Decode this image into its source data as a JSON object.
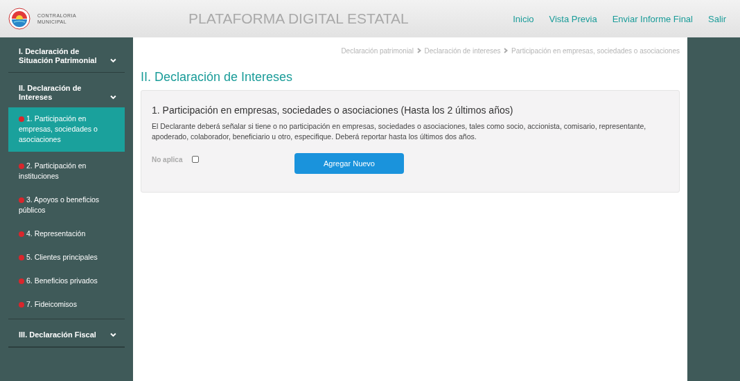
{
  "header": {
    "logo_text": [
      "CONTRALORIA",
      "MUNICIPAL"
    ],
    "title": "PLATAFORMA DIGITAL ESTATAL",
    "nav": [
      "Inicio",
      "Vista Previa",
      "Enviar Informe Final",
      "Salir"
    ]
  },
  "sidebar": {
    "sections": [
      {
        "label": "I. Declaración de Situación Patrimonial"
      },
      {
        "label": "II. Declaración de Intereses",
        "children": [
          {
            "label": "1. Participación en empresas, sociedades o asociaciones",
            "selected": true
          },
          {
            "label": "2. Participación en instituciones",
            "selected": false
          },
          {
            "label": "3. Apoyos o beneficios públicos",
            "selected": false
          },
          {
            "label": "4. Representación",
            "selected": false
          },
          {
            "label": "5. Clientes principales",
            "selected": false
          },
          {
            "label": "6. Beneficios privados",
            "selected": false
          },
          {
            "label": "7. Fideicomisos",
            "selected": false
          }
        ]
      },
      {
        "label": "III. Declaración Fiscal"
      }
    ]
  },
  "breadcrumb": [
    "Declaración patrimonial",
    "Declaración de intereses",
    "Participación en empresas, sociedades o asociaciones"
  ],
  "page_title": "II. Declaración de Intereses",
  "card": {
    "title": "1. Participación en empresas, sociedades o asociaciones (Hasta los 2 últimos años)",
    "description": "El Declarante deberá señalar si tiene o no participación en empresas, sociedades o asociaciones, tales como socio, accionista, comisario, representante, apoderado, colaborador, beneficiario u otro, especifique. Deberá reportar hasta los últimos dos años.",
    "not_applicable": {
      "label": "No aplica",
      "checked": false
    },
    "button": "Agregar Nuevo"
  }
}
